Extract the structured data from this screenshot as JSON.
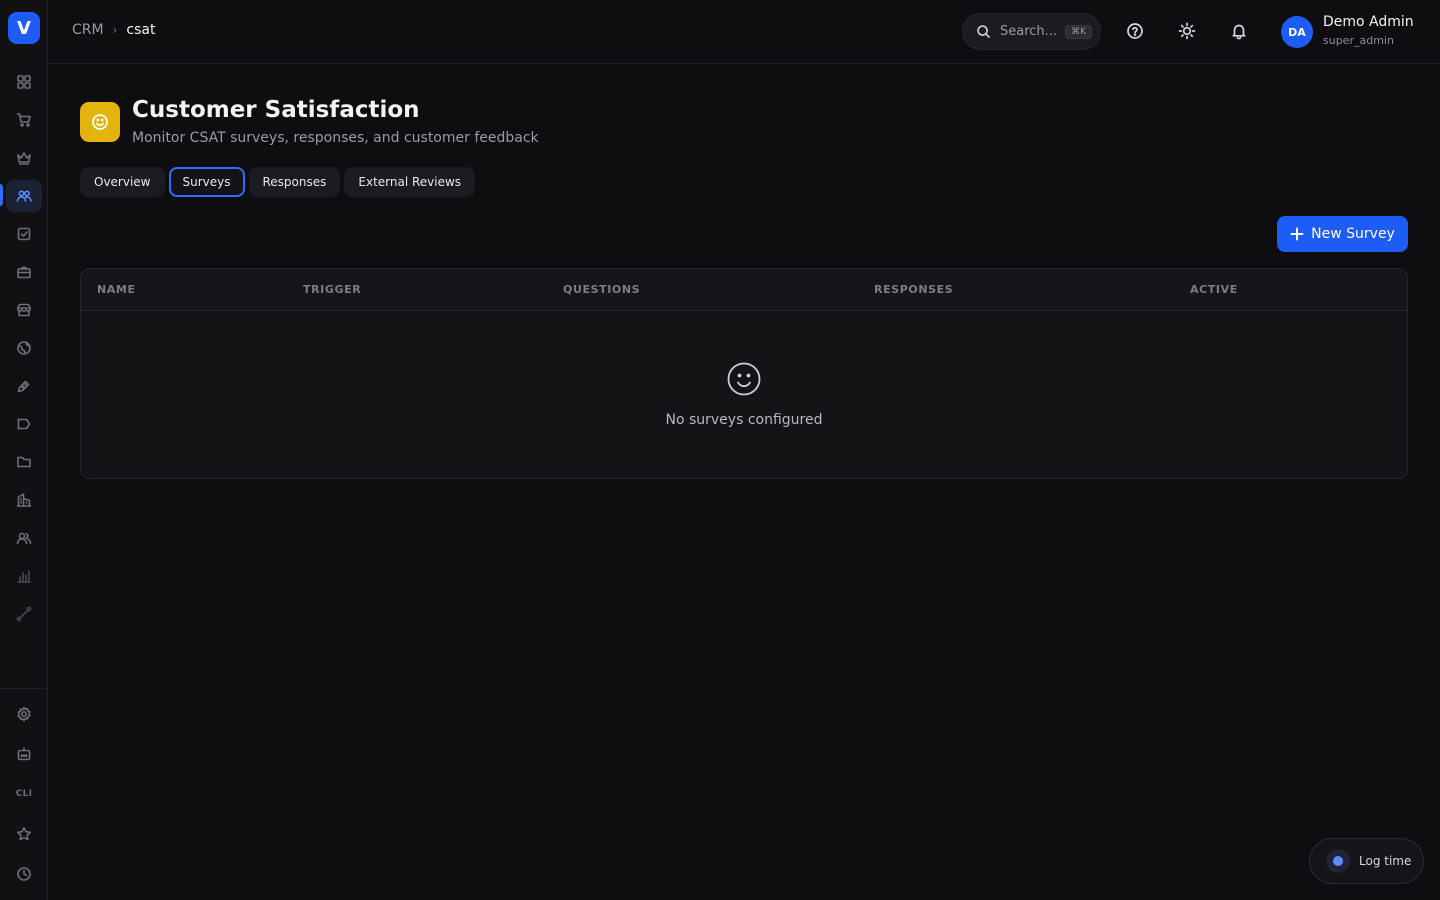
{
  "app": {
    "logo_letter": "V"
  },
  "breadcrumb": {
    "parent": "CRM",
    "separator": "›",
    "current": "csat"
  },
  "header": {
    "search_placeholder": "Search...",
    "search_shortcut": "⌘K",
    "user": {
      "initials": "DA",
      "name": "Demo Admin",
      "role": "super_admin"
    }
  },
  "page": {
    "title": "Customer Satisfaction",
    "subtitle": "Monitor CSAT surveys, responses, and customer feedback",
    "title_icon": "smile-icon",
    "accent_color": "#e3b40b"
  },
  "tabs": [
    {
      "label": "Overview",
      "active": false
    },
    {
      "label": "Surveys",
      "active": true
    },
    {
      "label": "Responses",
      "active": false
    },
    {
      "label": "External Reviews",
      "active": false
    }
  ],
  "actions": {
    "new_survey_label": "New Survey"
  },
  "table": {
    "columns": [
      "NAME",
      "TRIGGER",
      "QUESTIONS",
      "RESPONSES",
      "ACTIVE"
    ],
    "rows": [],
    "empty_text": "No surveys configured"
  },
  "sidebar": {
    "items": [
      "dashboard-icon",
      "cart-icon",
      "crown-icon",
      "users-icon",
      "checkbox-icon",
      "briefcase-icon",
      "store-icon",
      "globe-icon",
      "pen-icon",
      "megaphone-icon",
      "folder-icon",
      "building-icon",
      "team-icon",
      "bar-chart-icon",
      "route-icon"
    ],
    "active_item": "users-icon",
    "bottom_items": [
      "settings-icon",
      "robot-icon",
      "cli-label",
      "star-icon",
      "clock-icon"
    ],
    "cli_label": "CLI"
  },
  "log_time": {
    "label": "Log time"
  },
  "colors": {
    "primary": "#1d5cf5",
    "background": "#0e0e10",
    "sidebar": "#111113"
  }
}
